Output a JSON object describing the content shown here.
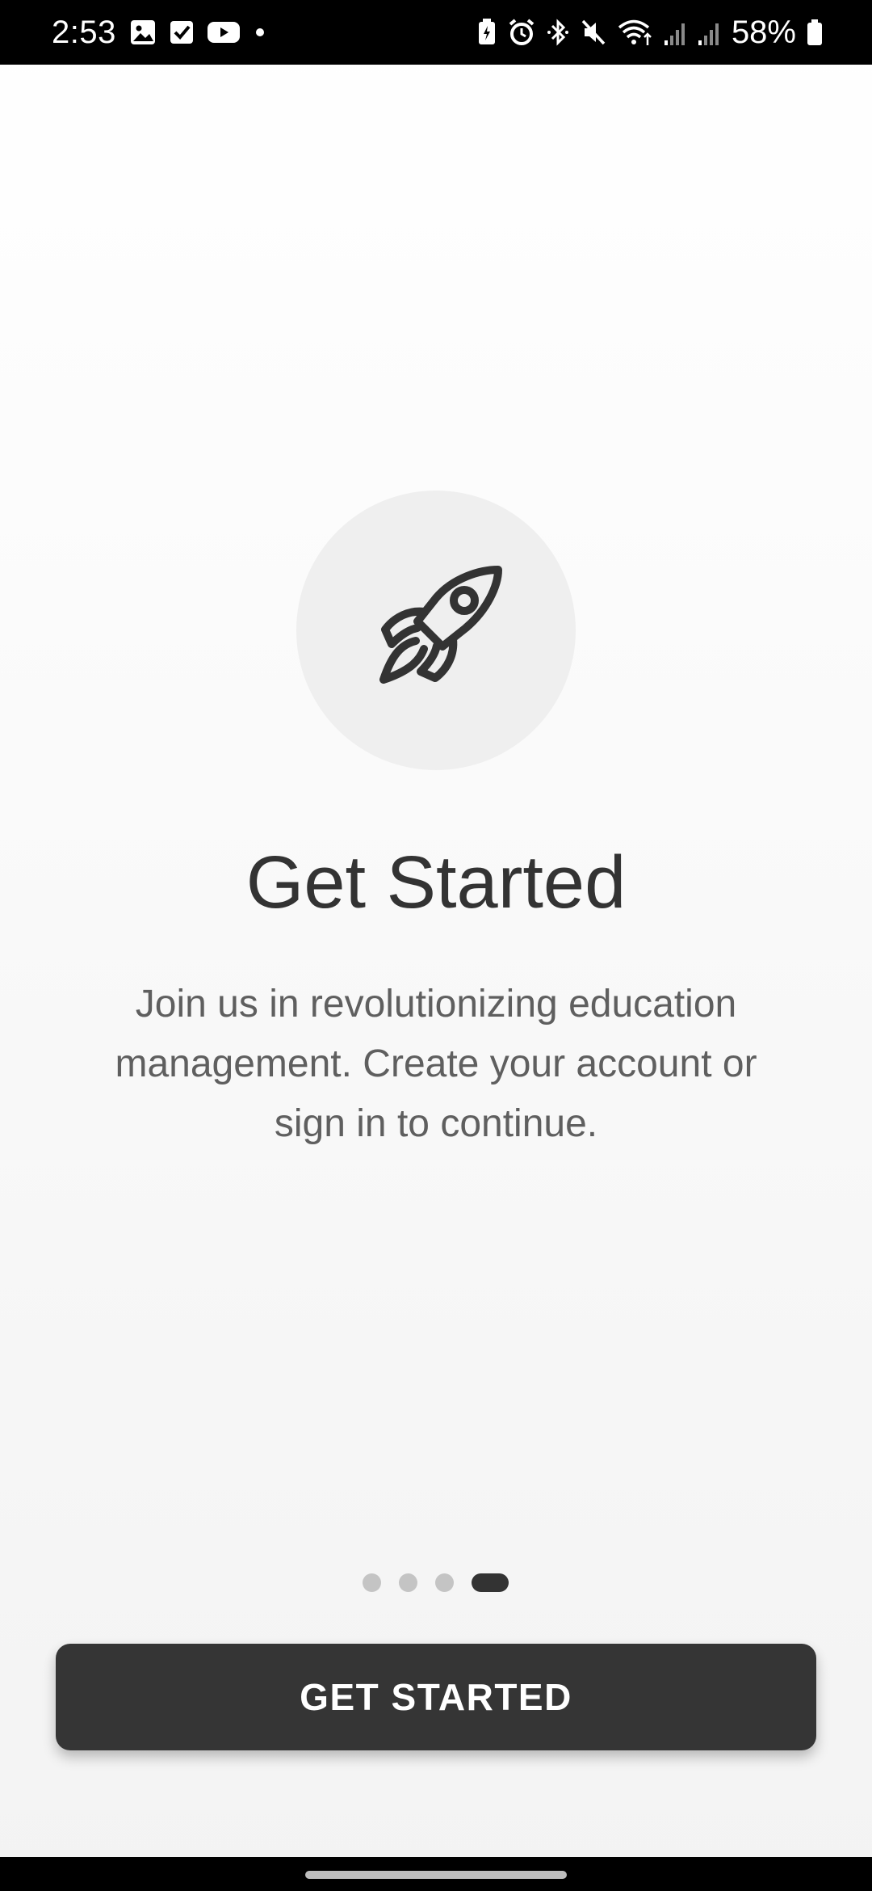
{
  "status_bar": {
    "time": "2:53",
    "battery_percent": "58%",
    "left_icons": [
      "gallery-icon",
      "checkbox-icon",
      "youtube-icon",
      "dot-icon"
    ],
    "right_icons": [
      "battery-saver-icon",
      "alarm-icon",
      "bluetooth-icon",
      "mute-icon",
      "wifi-icon",
      "signal-icon",
      "signal-icon",
      "battery-icon"
    ]
  },
  "onboarding": {
    "icon": "rocket-icon",
    "title": "Get Started",
    "description": "Join us in revolutionizing education management. Create your account or sign in to continue.",
    "page_count": 4,
    "active_page": 4,
    "button_label": "GET STARTED"
  },
  "colors": {
    "primary": "#353535",
    "text_dark": "#333333",
    "text_muted": "#5f5f5f",
    "circle_bg": "#efefef",
    "dot_inactive": "#c4c4c4"
  }
}
